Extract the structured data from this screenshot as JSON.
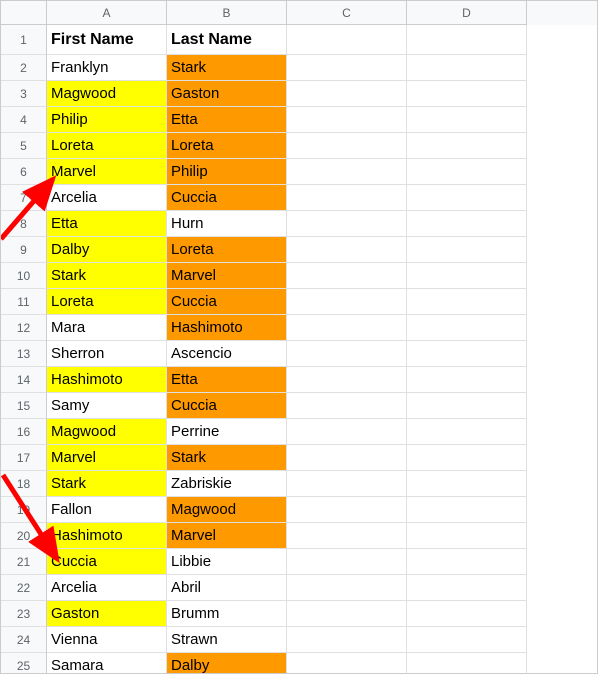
{
  "columns": [
    "A",
    "B",
    "C",
    "D"
  ],
  "chart_data": {
    "type": "table",
    "title": "",
    "headers": [
      "First Name",
      "Last Name"
    ],
    "rows": [
      {
        "first": "Franklyn",
        "last": "Stark",
        "a_hl": "",
        "b_hl": "orange"
      },
      {
        "first": "Magwood",
        "last": "Gaston",
        "a_hl": "yellow",
        "b_hl": "orange"
      },
      {
        "first": "Philip",
        "last": "Etta",
        "a_hl": "yellow",
        "b_hl": "orange"
      },
      {
        "first": "Loreta",
        "last": "Loreta",
        "a_hl": "yellow",
        "b_hl": "orange"
      },
      {
        "first": "Marvel",
        "last": "Philip",
        "a_hl": "yellow",
        "b_hl": "orange"
      },
      {
        "first": "Arcelia",
        "last": "Cuccia",
        "a_hl": "",
        "b_hl": "orange"
      },
      {
        "first": "Etta",
        "last": "Hurn",
        "a_hl": "yellow",
        "b_hl": ""
      },
      {
        "first": "Dalby",
        "last": "Loreta",
        "a_hl": "yellow",
        "b_hl": "orange"
      },
      {
        "first": "Stark",
        "last": "Marvel",
        "a_hl": "yellow",
        "b_hl": "orange"
      },
      {
        "first": "Loreta",
        "last": "Cuccia",
        "a_hl": "yellow",
        "b_hl": "orange"
      },
      {
        "first": "Mara",
        "last": "Hashimoto",
        "a_hl": "",
        "b_hl": "orange"
      },
      {
        "first": "Sherron",
        "last": "Ascencio",
        "a_hl": "",
        "b_hl": ""
      },
      {
        "first": "Hashimoto",
        "last": "Etta",
        "a_hl": "yellow",
        "b_hl": "orange"
      },
      {
        "first": "Samy",
        "last": "Cuccia",
        "a_hl": "",
        "b_hl": "orange"
      },
      {
        "first": "Magwood",
        "last": "Perrine",
        "a_hl": "yellow",
        "b_hl": ""
      },
      {
        "first": "Marvel",
        "last": "Stark",
        "a_hl": "yellow",
        "b_hl": "orange"
      },
      {
        "first": "Stark",
        "last": "Zabriskie",
        "a_hl": "yellow",
        "b_hl": ""
      },
      {
        "first": "Fallon",
        "last": "Magwood",
        "a_hl": "",
        "b_hl": "orange"
      },
      {
        "first": "Hashimoto",
        "last": "Marvel",
        "a_hl": "yellow",
        "b_hl": "orange"
      },
      {
        "first": "Cuccia",
        "last": "Libbie",
        "a_hl": "yellow",
        "b_hl": ""
      },
      {
        "first": "Arcelia",
        "last": "Abril",
        "a_hl": "",
        "b_hl": ""
      },
      {
        "first": "Gaston",
        "last": "Brumm",
        "a_hl": "yellow",
        "b_hl": ""
      },
      {
        "first": "Vienna",
        "last": "Strawn",
        "a_hl": "",
        "b_hl": ""
      },
      {
        "first": "Samara",
        "last": "Dalby",
        "a_hl": "",
        "b_hl": "orange"
      }
    ]
  },
  "colors": {
    "yellow": "#ffff00",
    "orange": "#ff9900",
    "arrow": "#ff0000"
  }
}
